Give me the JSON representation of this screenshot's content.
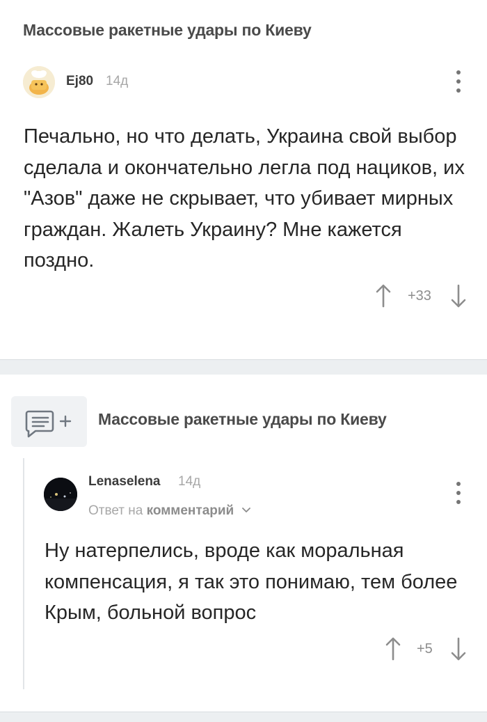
{
  "post1": {
    "title": "Массовые ракетные удары по Киеву",
    "comment": {
      "username": "Ej80",
      "time": "14д",
      "text": "Печально, но что делать, Украина свой выбор сделала и окончательно легла под нациков, их \"Азов\" даже не скрывает, что убивает мирных граждан. Жалеть Украину? Мне кажется поздно.",
      "rating": "+33"
    }
  },
  "post2": {
    "title": "Массовые ракетные удары по Киеву",
    "comment": {
      "username": "Lenaselena",
      "time": "14д",
      "reply_prefix": "Ответ на",
      "reply_target": "комментарий",
      "text": "Ну натерпелись, вроде как моральная компенсация, я так это понимаю, тем более Крым, больной вопрос",
      "rating": "+5"
    }
  },
  "icons": {
    "add_comment": "comment-add-icon",
    "more": "kebab-menu-icon",
    "upvote": "arrow-up-icon",
    "downvote": "arrow-down-icon"
  },
  "colors": {
    "background": "#ffffff",
    "separator": "#eceff1",
    "muted": "#a7a7a7"
  }
}
